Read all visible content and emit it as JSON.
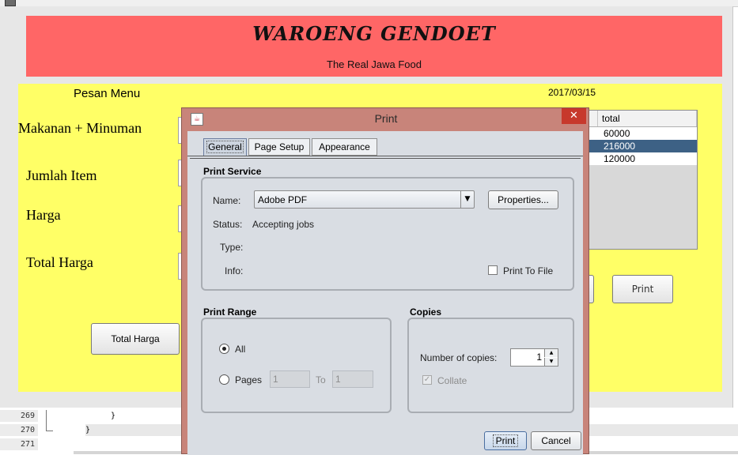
{
  "app": {
    "title": "WAROENG GENDOET",
    "subtitle": "The Real Jawa Food",
    "section_label": "Pesan Menu",
    "date": "2017/03/15",
    "field_labels": [
      "Makanan + Minuman",
      "Jumlah Item",
      "Harga",
      "Total Harga"
    ],
    "total_button": "Total Harga",
    "print_button": "Print",
    "table": {
      "headers": [
        "",
        "",
        "",
        "total"
      ],
      "rows": [
        {
          "total": "60000",
          "selected": false
        },
        {
          "total": "216000",
          "selected": true
        },
        {
          "total": "120000",
          "selected": false
        }
      ]
    }
  },
  "dialog": {
    "title": "Print",
    "tabs": [
      "General",
      "Page Setup",
      "Appearance"
    ],
    "print_service": {
      "heading": "Print Service",
      "name_label": "Name:",
      "printer": "Adobe PDF",
      "properties_button": "Properties...",
      "status_label": "Status:",
      "status_value": "Accepting jobs",
      "type_label": "Type:",
      "info_label": "Info:",
      "print_to_file_label": "Print To File",
      "print_to_file_checked": false
    },
    "print_range": {
      "heading": "Print Range",
      "all_label": "All",
      "all_selected": true,
      "pages_label": "Pages",
      "from_value": "1",
      "to_label": "To",
      "to_value": "1"
    },
    "copies": {
      "heading": "Copies",
      "number_label": "Number of copies:",
      "number_value": "1",
      "collate_label": "Collate",
      "collate_checked": true
    },
    "buttons": {
      "print": "Print",
      "cancel": "Cancel"
    }
  },
  "editor": {
    "line_numbers": [
      "269",
      "270",
      "271"
    ],
    "lines": [
      "}",
      "}",
      ""
    ]
  },
  "colors": {
    "header_bg": "#ff6666",
    "form_bg": "#ffff66",
    "dialog_frame": "#c8847a",
    "selection": "#3d6185",
    "close_button": "#c7392c"
  }
}
